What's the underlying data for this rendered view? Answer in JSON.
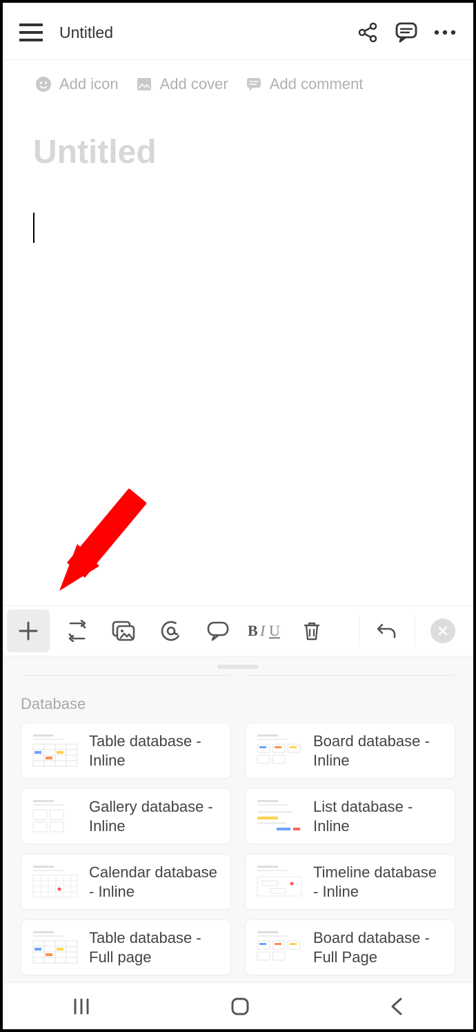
{
  "header": {
    "title": "Untitled"
  },
  "page_actions": {
    "add_icon": "Add icon",
    "add_cover": "Add cover",
    "add_comment": "Add comment"
  },
  "title_placeholder": "Untitled",
  "panel": {
    "section_label": "Database",
    "items": [
      {
        "label": "Table database - Inline",
        "thumb": "table"
      },
      {
        "label": "Board database - Inline",
        "thumb": "board"
      },
      {
        "label": "Gallery database - Inline",
        "thumb": "gallery"
      },
      {
        "label": "List database - Inline",
        "thumb": "list"
      },
      {
        "label": "Calendar database - Inline",
        "thumb": "calendar"
      },
      {
        "label": "Timeline database - Inline",
        "thumb": "timeline"
      },
      {
        "label": "Table database - Full page",
        "thumb": "table"
      },
      {
        "label": "Board database - Full Page",
        "thumb": "board"
      }
    ]
  }
}
